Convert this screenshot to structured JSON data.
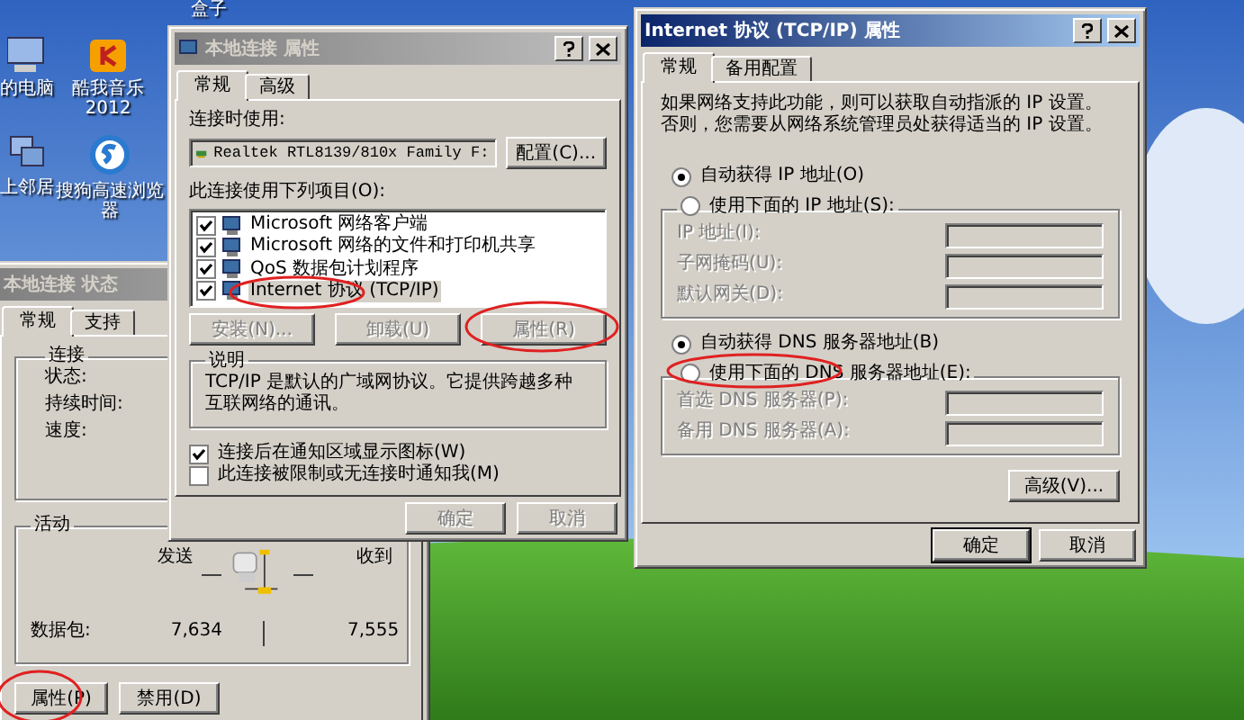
{
  "desktop_icons": [
    {
      "label": "盒子",
      "kind": "none"
    },
    {
      "label": "的电脑",
      "kind": "computer"
    },
    {
      "label": "酷我音乐 2012",
      "kind": "music"
    },
    {
      "label": "上邻居",
      "kind": "network"
    },
    {
      "label": "搜狗高速浏览器",
      "kind": "browser"
    }
  ],
  "status_window": {
    "title": "本地连接 状态",
    "active": false,
    "tabs": [
      {
        "label": "常规",
        "selected": true
      },
      {
        "label": "支持",
        "selected": false
      }
    ],
    "connection_group": {
      "title": "连接",
      "fields": [
        "状态:",
        "持续时间:",
        "速度:"
      ]
    },
    "activity_group": {
      "title": "活动",
      "sent_label": "发送",
      "received_label": "收到",
      "packets_label": "数据包:",
      "sent": "7,634",
      "received": "7,555"
    },
    "buttons": [
      {
        "label": "属性(P)",
        "disabled": false
      },
      {
        "label": "禁用(D)",
        "disabled": false
      }
    ]
  },
  "properties_window": {
    "title": "本地连接 属性",
    "active": false,
    "tabs": [
      {
        "label": "常规",
        "selected": true
      },
      {
        "label": "高级",
        "selected": false
      }
    ],
    "connect_using_label": "连接时使用:",
    "adapter": "Realtek RTL8139/810x Family F:",
    "configure_button": "配置(C)...",
    "items_label": "此连接使用下列项目(O):",
    "items": [
      {
        "label": "Microsoft 网络客户端",
        "checked": true,
        "selected": false
      },
      {
        "label": "Microsoft 网络的文件和打印机共享",
        "checked": true,
        "selected": false
      },
      {
        "label": "QoS 数据包计划程序",
        "checked": true,
        "selected": false
      },
      {
        "label": "Internet 协议 (TCP/IP)",
        "checked": true,
        "selected": true
      }
    ],
    "item_buttons": [
      {
        "label": "安装(N)...",
        "disabled": true
      },
      {
        "label": "卸载(U)",
        "disabled": true
      },
      {
        "label": "属性(R)",
        "disabled": true
      }
    ],
    "description": {
      "title": "说明",
      "text": "TCP/IP 是默认的广域网协议。它提供跨越多种互联网络的通讯。"
    },
    "options": [
      {
        "label": "连接后在通知区域显示图标(W)",
        "checked": true
      },
      {
        "label": "此连接被限制或无连接时通知我(M)",
        "checked": false
      }
    ],
    "buttons": [
      {
        "label": "确定",
        "disabled": true
      },
      {
        "label": "取消",
        "disabled": true
      }
    ]
  },
  "tcpip_window": {
    "title": "Internet 协议 (TCP/IP) 属性",
    "active": true,
    "tabs": [
      {
        "label": "常规",
        "selected": true
      },
      {
        "label": "备用配置",
        "selected": false
      }
    ],
    "intro": "如果网络支持此功能，则可以获取自动指派的 IP 设置。否则，您需要从网络系统管理员处获得适当的 IP 设置。",
    "ip_mode": [
      {
        "label": "自动获得 IP 地址(O)",
        "selected": true
      },
      {
        "label": "使用下面的 IP 地址(S):",
        "selected": false
      }
    ],
    "ip_fields": [
      {
        "label": "IP 地址(I):",
        "disabled": true
      },
      {
        "label": "子网掩码(U):",
        "disabled": true
      },
      {
        "label": "默认网关(D):",
        "disabled": true
      }
    ],
    "dns_mode": [
      {
        "label": "自动获得 DNS 服务器地址(B)",
        "selected": true
      },
      {
        "label": "使用下面的 DNS 服务器地址(E):",
        "selected": false
      }
    ],
    "dns_fields": [
      {
        "label": "首选 DNS 服务器(P):",
        "disabled": true
      },
      {
        "label": "备用 DNS 服务器(A):",
        "disabled": true
      }
    ],
    "advanced_button": "高级(V)...",
    "buttons": [
      {
        "label": "确定",
        "default": true
      },
      {
        "label": "取消",
        "default": false
      }
    ]
  }
}
